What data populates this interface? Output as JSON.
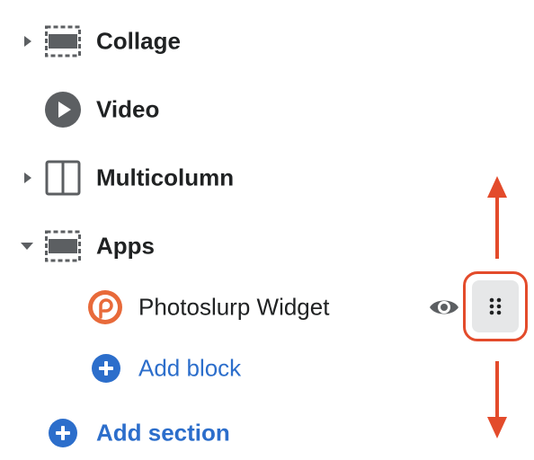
{
  "sections": [
    {
      "id": "collage",
      "label": "Collage",
      "expandable": true,
      "expanded": false,
      "icon": "collage-icon"
    },
    {
      "id": "video",
      "label": "Video",
      "expandable": false,
      "icon": "play-circle-icon"
    },
    {
      "id": "multicolumn",
      "label": "Multicolumn",
      "expandable": true,
      "expanded": false,
      "icon": "multicolumn-icon"
    },
    {
      "id": "apps",
      "label": "Apps",
      "expandable": true,
      "expanded": true,
      "icon": "apps-icon"
    }
  ],
  "apps_blocks": [
    {
      "label": "Photoslurp Widget",
      "icon": "photoslurp-logo-icon"
    }
  ],
  "add_block_label": "Add block",
  "add_section_label": "Add section",
  "colors": {
    "text": "#202223",
    "icon_gray": "#5c5f62",
    "link_blue": "#2c6ecb",
    "highlight_red": "#e34b2b",
    "photoslurp_orange": "#e86a3a",
    "handle_bg": "#e6e7e8"
  }
}
